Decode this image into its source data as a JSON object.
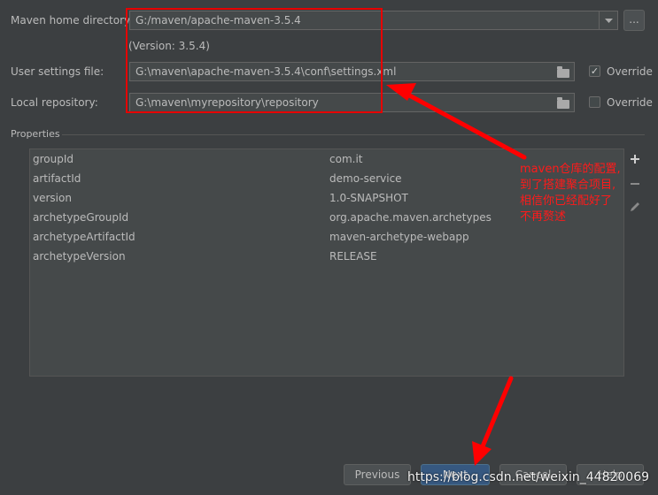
{
  "maven_home": {
    "label": "Maven home directory:",
    "value": "G:/maven/apache-maven-3.5.4",
    "version": "(Version: 3.5.4)",
    "browse_label": "..."
  },
  "user_settings": {
    "label": "User settings file:",
    "value": "G:\\maven\\apache-maven-3.5.4\\conf\\settings.xml",
    "override_label": "Override",
    "override_checked": true
  },
  "local_repo": {
    "label": "Local repository:",
    "value": "G:\\maven\\myrepository\\repository",
    "override_label": "Override",
    "override_checked": false
  },
  "properties": {
    "title": "Properties",
    "rows": [
      {
        "key": "groupId",
        "value": "com.it"
      },
      {
        "key": "artifactId",
        "value": "demo-service"
      },
      {
        "key": "version",
        "value": "1.0-SNAPSHOT"
      },
      {
        "key": "archetypeGroupId",
        "value": "org.apache.maven.archetypes"
      },
      {
        "key": "archetypeArtifactId",
        "value": "maven-archetype-webapp"
      },
      {
        "key": "archetypeVersion",
        "value": "RELEASE"
      }
    ]
  },
  "annotation": {
    "lines": [
      "maven仓库的配置,",
      "到了搭建聚合项目,",
      "相信你已经配好了",
      "不再赘述"
    ]
  },
  "buttons": {
    "previous": "Previous",
    "next": "Next",
    "cancel": "Cancel",
    "help": "Help"
  },
  "watermark": "https://blog.csdn.net/weixin_44820069",
  "colors": {
    "background": "#3c3f41",
    "annotation": "#ff1a1a",
    "primary_button": "#365880"
  }
}
